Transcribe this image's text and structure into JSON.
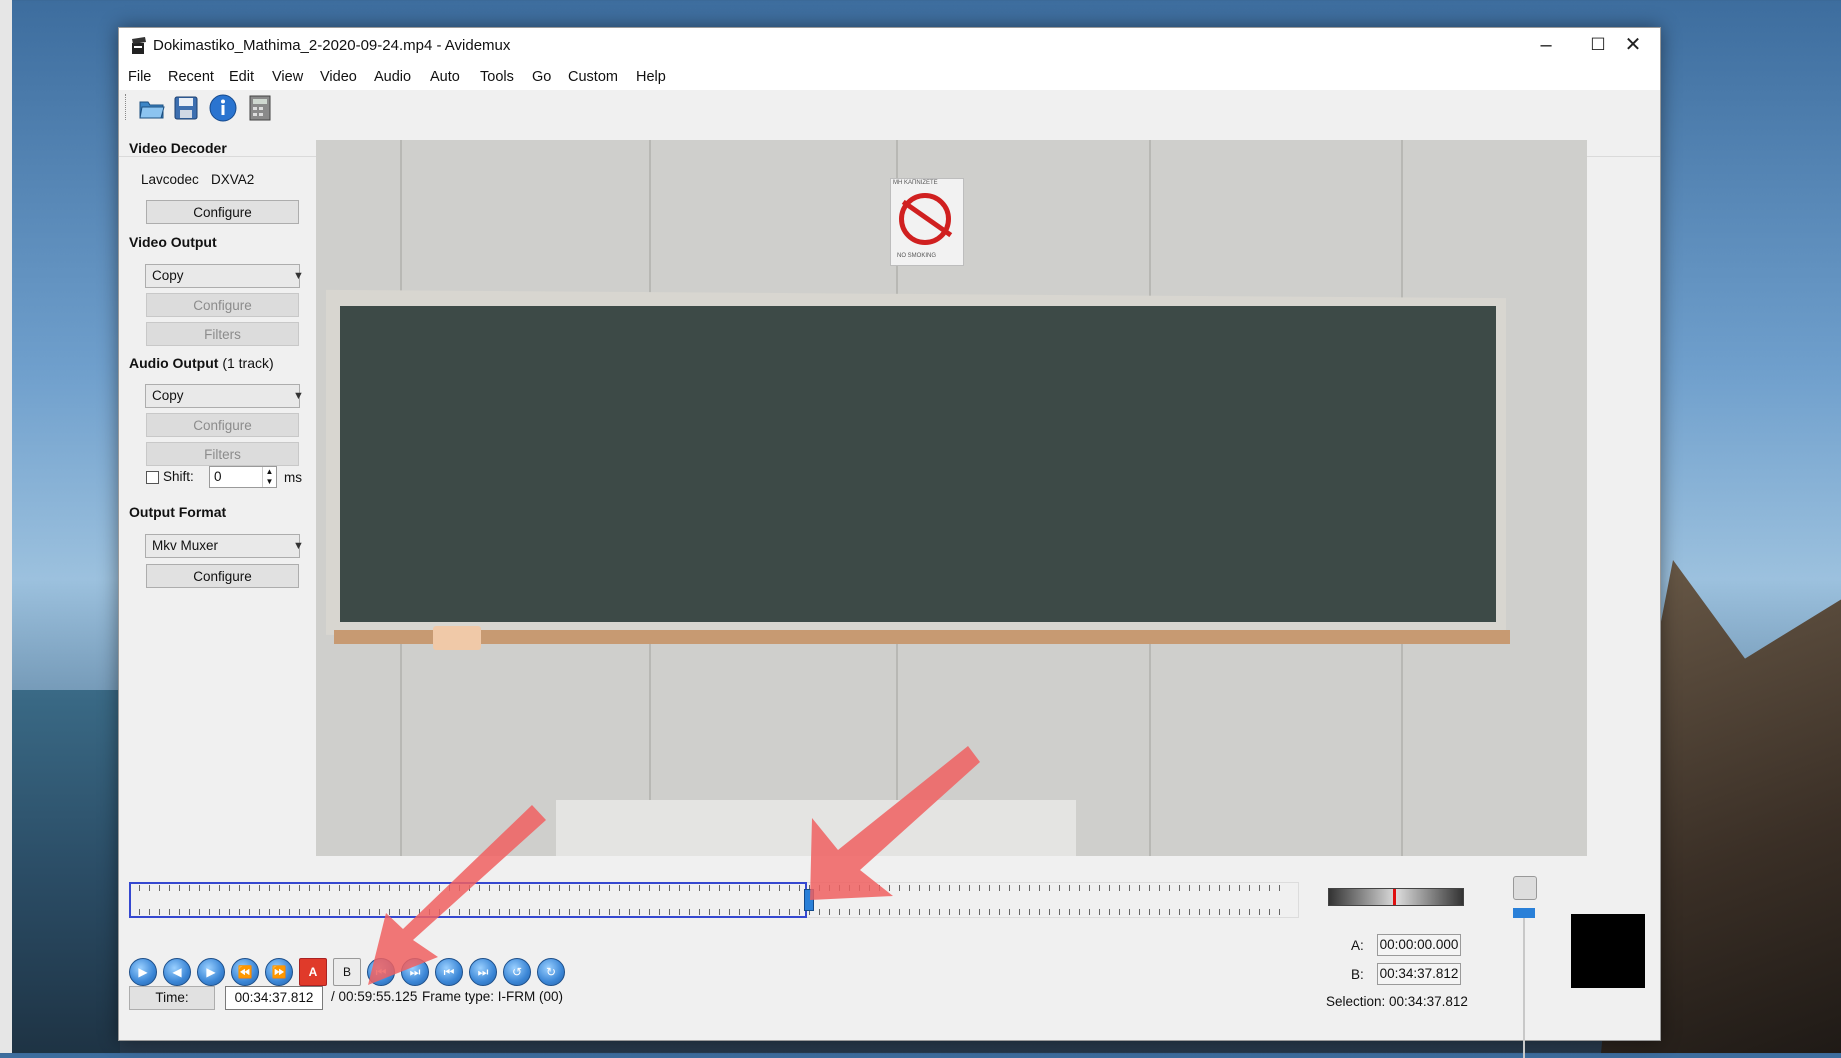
{
  "window": {
    "title": "Dokimastiko_Mathima_2-2020-09-24.mp4 - Avidemux",
    "minimize": "–",
    "maximize": "☐",
    "close": "✕"
  },
  "menu": [
    "File",
    "Recent",
    "Edit",
    "View",
    "Video",
    "Audio",
    "Auto",
    "Tools",
    "Go",
    "Custom",
    "Help"
  ],
  "toolbar": {
    "icons": [
      "open-icon",
      "save-icon",
      "info-icon",
      "calculator-icon"
    ]
  },
  "video_decoder": {
    "title": "Video Decoder",
    "codec": "Lavcodec",
    "accel": "DXVA2",
    "configure": "Configure"
  },
  "video_output": {
    "title": "Video Output",
    "selected": "Copy",
    "configure": "Configure",
    "filters": "Filters"
  },
  "audio_output": {
    "title": "Audio Output",
    "tracks": "(1 track)",
    "selected": "Copy",
    "configure": "Configure",
    "filters": "Filters",
    "shift_label": "Shift:",
    "shift_value": "0",
    "shift_unit": "ms"
  },
  "output_format": {
    "title": "Output Format",
    "selected": "Mkv Muxer",
    "configure": "Configure"
  },
  "video_frame": {
    "sign_top": "ΜΗ ΚΑΠΝΙΖΕΤΕ",
    "sign_bottom": "NO SMOKING"
  },
  "timeline": {
    "position_fraction": 0.58
  },
  "controls": {
    "marker_a": "A",
    "marker_b": "B"
  },
  "status": {
    "time_button": "Time:",
    "current_time": "00:34:37.812",
    "duration": "/ 00:59:55.125",
    "frame_type": "Frame type:  I-FRM (00)"
  },
  "ab": {
    "a_label": "A:",
    "a_value": "00:00:00.000",
    "b_label": "B:",
    "b_value": "00:34:37.812",
    "selection": "Selection: 00:34:37.812"
  },
  "colors": {
    "accent": "#2a80d8",
    "selection_border": "#3548d0",
    "annotation_arrow": "#f06060"
  }
}
